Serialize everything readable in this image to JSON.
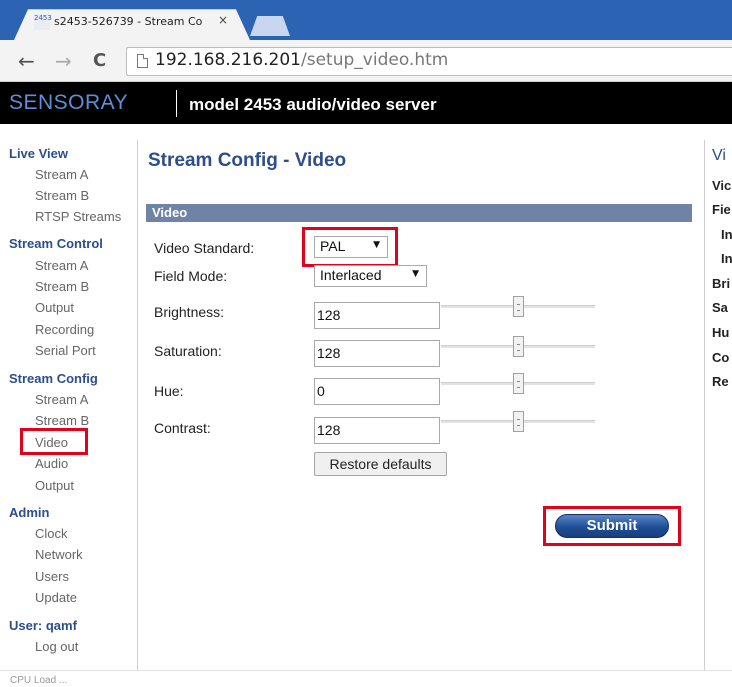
{
  "browser": {
    "tab_title": "s2453-526739 - Stream Co",
    "tab_close": "×",
    "favicon_text": "2453",
    "nav": {
      "back": "←",
      "forward": "→",
      "reload": "C"
    },
    "url_host": "192.168.216.201",
    "url_path": "/setup_video.htm"
  },
  "header": {
    "brand": "SENSORAY",
    "model": "model 2453 audio/video server"
  },
  "sidebar": {
    "live_view": {
      "heading": "Live View",
      "items": [
        "Stream A",
        "Stream B",
        "RTSP Streams"
      ]
    },
    "stream_control": {
      "heading": "Stream Control",
      "items": [
        "Stream A",
        "Stream B",
        "Output",
        "Recording",
        "Serial Port"
      ]
    },
    "stream_config": {
      "heading": "Stream Config",
      "items": [
        "Stream A",
        "Stream B",
        "Video",
        "Audio",
        "Output"
      ]
    },
    "admin": {
      "heading": "Admin",
      "items": [
        "Clock",
        "Network",
        "Users",
        "Update"
      ]
    },
    "user": {
      "heading": "User: qamf",
      "items": [
        "Log out"
      ]
    }
  },
  "main": {
    "title": "Stream Config - Video",
    "section": "Video",
    "video_standard": {
      "label": "Video Standard:",
      "value": "PAL"
    },
    "field_mode": {
      "label": "Field Mode:",
      "value": "Interlaced"
    },
    "brightness": {
      "label": "Brightness:",
      "value": "128",
      "level": 0.5
    },
    "saturation": {
      "label": "Saturation:",
      "value": "128",
      "level": 0.5
    },
    "hue": {
      "label": "Hue:",
      "value": "0",
      "level": 0.5
    },
    "contrast": {
      "label": "Contrast:",
      "value": "128",
      "level": 0.5
    },
    "restore_label": "Restore defaults",
    "submit_label": "Submit"
  },
  "right_column": {
    "title": "Vi",
    "items": [
      "Vic",
      "Fie",
      "In",
      "In",
      "Bri",
      "Sa",
      "Hu",
      "Co",
      "Re"
    ]
  },
  "footer": {
    "cpu_load": "CPU Load ..."
  },
  "colors": {
    "tabstrip": "#2d63b3",
    "heading_blue": "#2c4e8c",
    "section_bar": "#6f84a4",
    "highlight": "#e3001b"
  }
}
